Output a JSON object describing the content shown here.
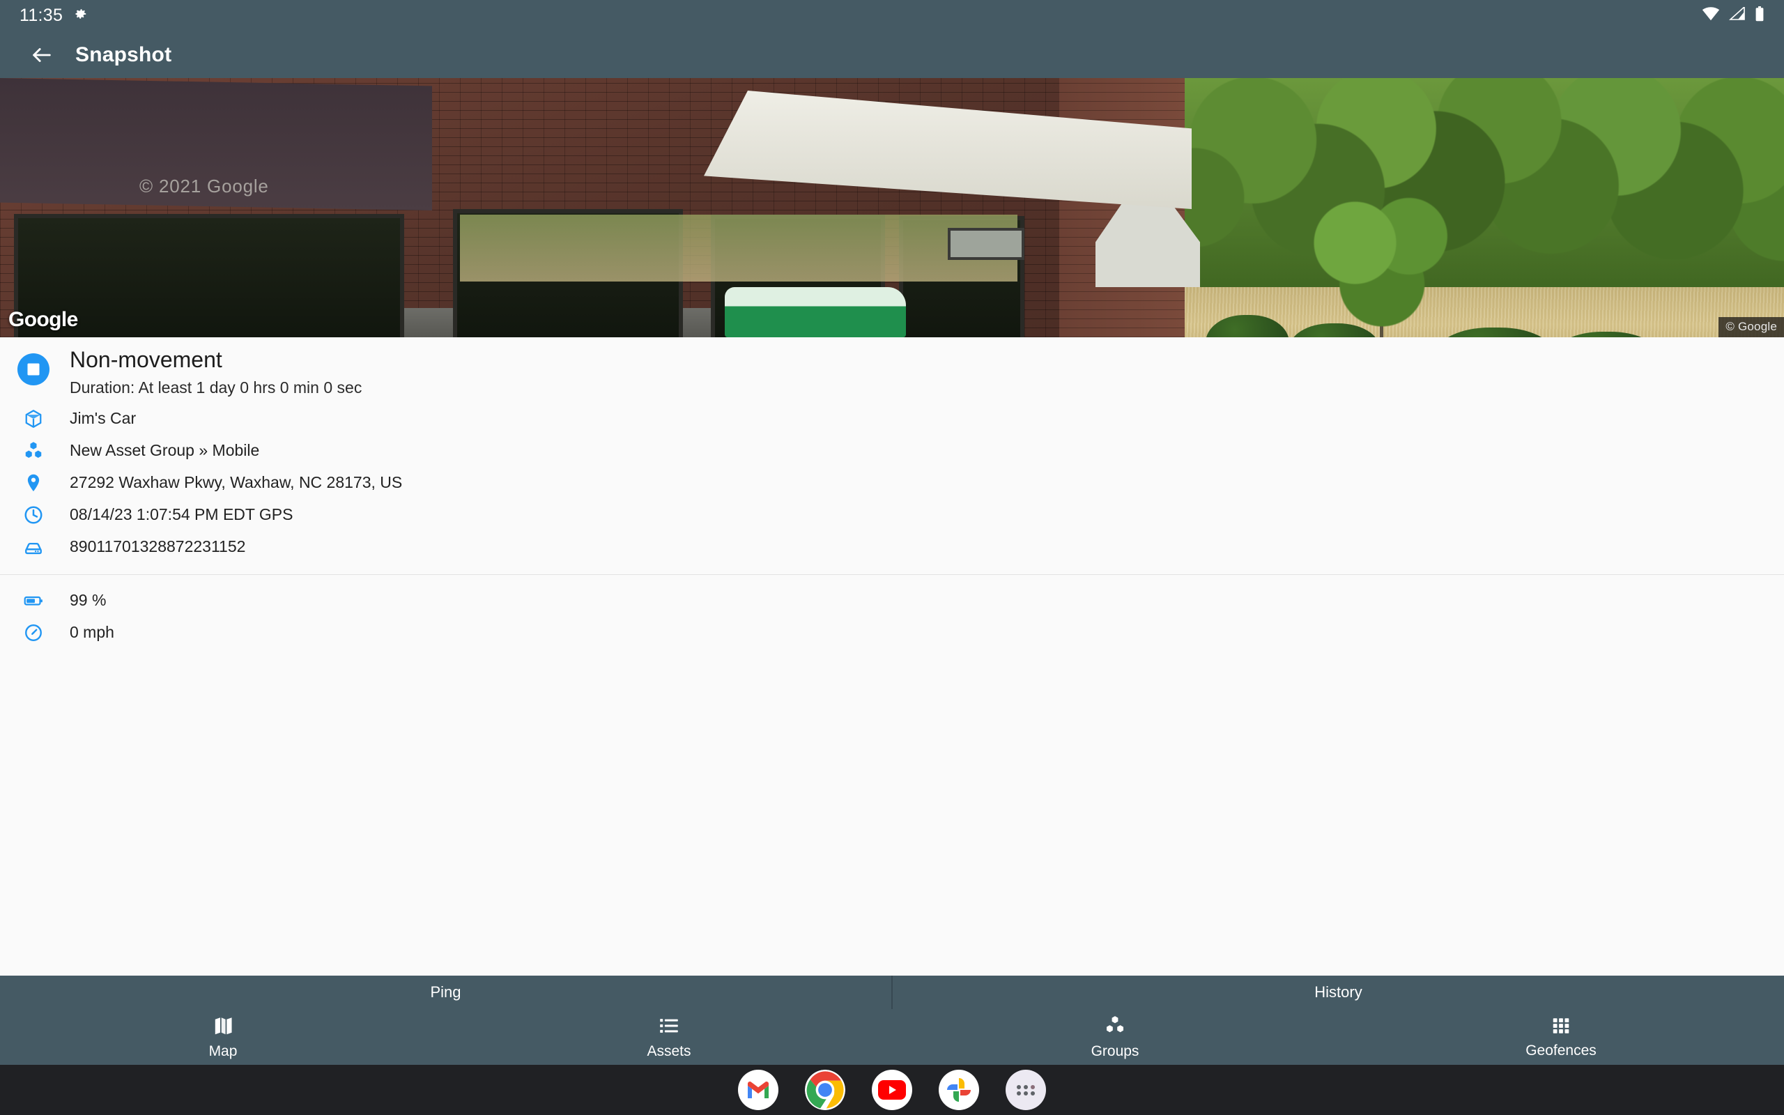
{
  "status_bar": {
    "clock": "11:35",
    "left_icons": [
      "settings-gear-icon"
    ],
    "right_icons": [
      "wifi-icon",
      "cellular-signal-icon",
      "battery-icon"
    ]
  },
  "app_bar": {
    "back_label": "back-arrow-icon",
    "title": "Snapshot"
  },
  "street_view": {
    "watermark_year": "© 2021 Google",
    "logo": "Google",
    "attribution": "© Google"
  },
  "snapshot": {
    "event_icon": "stop-square-icon",
    "event_title": "Non-movement",
    "event_duration": "Duration: At least 1 day 0 hrs 0 min 0 sec",
    "rows": [
      {
        "icon": "cube-icon",
        "name": "asset-name",
        "value": "Jim's Car"
      },
      {
        "icon": "cube-stack-icon",
        "name": "asset-group",
        "value": "New Asset Group » Mobile"
      },
      {
        "icon": "map-pin-icon",
        "name": "address",
        "value": "27292 Waxhaw Pkwy, Waxhaw, NC 28173, US"
      },
      {
        "icon": "clock-icon",
        "name": "timestamp",
        "value": "08/14/23 1:07:54 PM EDT GPS"
      },
      {
        "icon": "device-icon",
        "name": "device-id",
        "value": "89011701328872231152"
      }
    ],
    "telemetry": [
      {
        "icon": "battery-icon",
        "name": "battery-level",
        "value": "99 %"
      },
      {
        "icon": "speedometer-icon",
        "name": "speed",
        "value": "0 mph"
      }
    ]
  },
  "ping_history_tabs": [
    {
      "label": "Ping"
    },
    {
      "label": "History"
    }
  ],
  "bottom_nav": [
    {
      "icon": "map-icon",
      "label": "Map"
    },
    {
      "icon": "list-icon",
      "label": "Assets"
    },
    {
      "icon": "groups-icon",
      "label": "Groups"
    },
    {
      "icon": "grid-icon",
      "label": "Geofences"
    }
  ],
  "taskbar": {
    "apps": [
      {
        "name": "gmail-app-icon",
        "label": "Gmail"
      },
      {
        "name": "chrome-app-icon",
        "label": "Chrome"
      },
      {
        "name": "youtube-app-icon",
        "label": "YouTube"
      },
      {
        "name": "google-photos-app-icon",
        "label": "Photos"
      },
      {
        "name": "app-drawer-icon",
        "label": "All apps"
      }
    ]
  },
  "colors": {
    "app_bar": "#455a64",
    "accent": "#2196f3",
    "background": "#fafafa",
    "taskbar": "#202124"
  }
}
